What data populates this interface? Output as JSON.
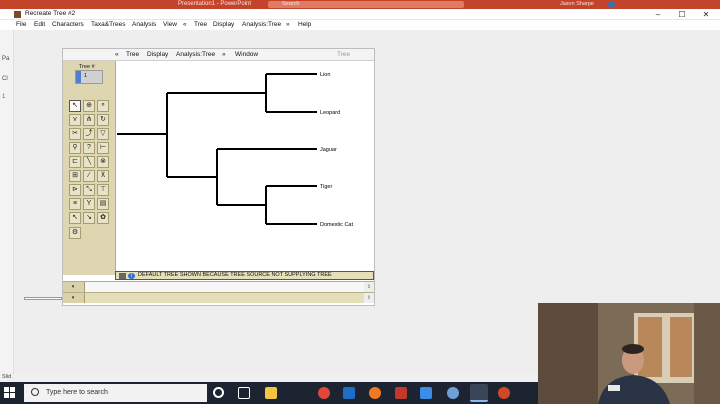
{
  "ppt": {
    "title": "Presentation1 - PowerPoint",
    "search_placeholder": "Search",
    "user": "Jason Sharpe",
    "left_labels": [
      "Fi",
      "Pa",
      "Cl",
      "1"
    ],
    "status": "Slid"
  },
  "mesquite": {
    "window_title": "Recreate Tree #2",
    "menu": [
      "File",
      "Edit",
      "Characters",
      "Taxa&Trees",
      "Analysis",
      "View",
      "«",
      "Tree",
      "Display",
      "Analysis:Tree",
      "»",
      "Help"
    ],
    "window_buttons": [
      "–",
      "☐",
      "✕"
    ]
  },
  "tree_window": {
    "menu": [
      "«",
      "Tree",
      "Display",
      "Analysis:Tree",
      "»",
      "Window"
    ],
    "menu_right": "Tree",
    "tree_number_label": "Tree #",
    "tree_number_value": "1",
    "taxa": [
      "Lion",
      "Leopard",
      "Jaguar",
      "Tiger",
      "Domestic Cat"
    ],
    "status_message": "DEFAULT TREE SHOWN BECAUSE TREE SOURCE NOT SUPPLYING TREE"
  },
  "taskbar": {
    "search_placeholder": "Type here to search",
    "icons": [
      {
        "name": "task-view-icon",
        "color": "#ffffff"
      },
      {
        "name": "file-explorer-icon",
        "color": "#f4c542"
      },
      {
        "name": "chrome-icon",
        "color": "#e0463a"
      },
      {
        "name": "outlook-icon",
        "color": "#1e6ec8"
      },
      {
        "name": "firefox-icon",
        "color": "#f07a22"
      },
      {
        "name": "mesquite-icon",
        "color": "#c0392b"
      },
      {
        "name": "mail-icon",
        "color": "#3a8ee6"
      },
      {
        "name": "r-icon",
        "color": "#6fa0d8"
      },
      {
        "name": "java-icon",
        "color": "#d8d8d8"
      },
      {
        "name": "powerpoint-icon",
        "color": "#d24726"
      }
    ]
  }
}
